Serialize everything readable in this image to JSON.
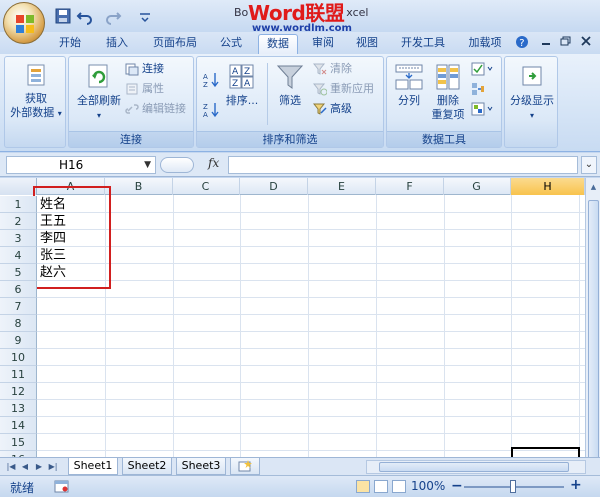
{
  "window": {
    "title_prefix": "Bo",
    "title_suffix": "xcel",
    "watermark_logo": "Word联盟",
    "watermark_url": "www.wordlm.com"
  },
  "tabs": [
    {
      "label": "开始"
    },
    {
      "label": "插入"
    },
    {
      "label": "页面布局"
    },
    {
      "label": "公式"
    },
    {
      "label": "数据",
      "active": true
    },
    {
      "label": "审阅"
    },
    {
      "label": "视图"
    },
    {
      "label": "开发工具"
    },
    {
      "label": "加载项"
    }
  ],
  "ribbon": {
    "get_external": {
      "line1": "获取",
      "line2": "外部数据"
    },
    "connections": {
      "label": "连接",
      "refresh_all": "全部刷新",
      "connections_btn": "连接",
      "properties": "属性",
      "edit_links": "编辑链接"
    },
    "sort_filter": {
      "label": "排序和筛选",
      "sort": "排序...",
      "filter": "筛选",
      "clear": "清除",
      "reapply": "重新应用",
      "advanced": "高级"
    },
    "data_tools": {
      "label": "数据工具",
      "text_to_columns": "分列",
      "remove_dup_1": "删除",
      "remove_dup_2": "重复项"
    },
    "outline": {
      "label": "分级显示"
    }
  },
  "formula_bar": {
    "name_box": "H16",
    "fx": "fx",
    "formula": ""
  },
  "sheet": {
    "columns": [
      "A",
      "B",
      "C",
      "D",
      "E",
      "F",
      "G",
      "H"
    ],
    "selected_column": "H",
    "rows": [
      "1",
      "2",
      "3",
      "4",
      "5",
      "6",
      "7",
      "8",
      "9",
      "10",
      "11",
      "12",
      "13",
      "14",
      "15",
      "16"
    ],
    "cells_a": [
      "姓名",
      "王五",
      "李四",
      "张三",
      "赵六"
    ]
  },
  "sheet_tabs": [
    "Sheet1",
    "Sheet2",
    "Sheet3"
  ],
  "status": {
    "ready": "就绪",
    "zoom": "100%"
  },
  "colors": {
    "accent": "#15428b",
    "highlight": "#d11f1f",
    "selected_header": "#f8c34d"
  }
}
